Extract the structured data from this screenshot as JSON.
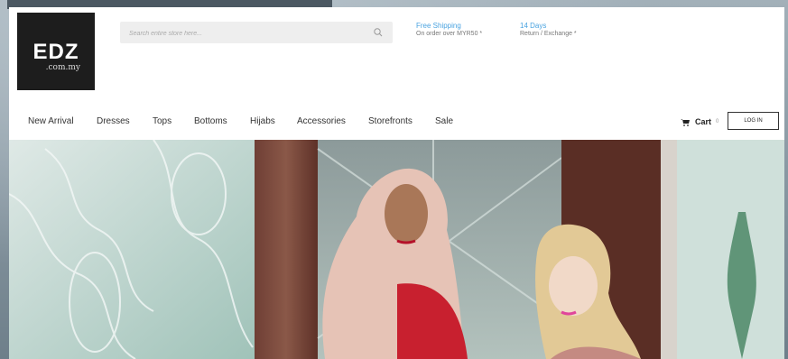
{
  "brand": {
    "name": "EDZ",
    "domain": ".com.my"
  },
  "search": {
    "placeholder": "Search entire store here..."
  },
  "promos": [
    {
      "title": "Free Shipping",
      "subtitle": "On order over MYR50 *"
    },
    {
      "title": "14 Days",
      "subtitle": "Return / Exchange *"
    }
  ],
  "nav": {
    "items": [
      {
        "label": "New Arrival"
      },
      {
        "label": "Dresses"
      },
      {
        "label": "Tops"
      },
      {
        "label": "Bottoms"
      },
      {
        "label": "Hijabs"
      },
      {
        "label": "Accessories"
      },
      {
        "label": "Storefronts"
      },
      {
        "label": "Sale"
      }
    ]
  },
  "cart": {
    "label": "Cart",
    "count": "0"
  },
  "login": {
    "label": "LOG IN"
  },
  "colors": {
    "accent": "#4aa3e0",
    "logo_bg": "#1d1d1d"
  }
}
